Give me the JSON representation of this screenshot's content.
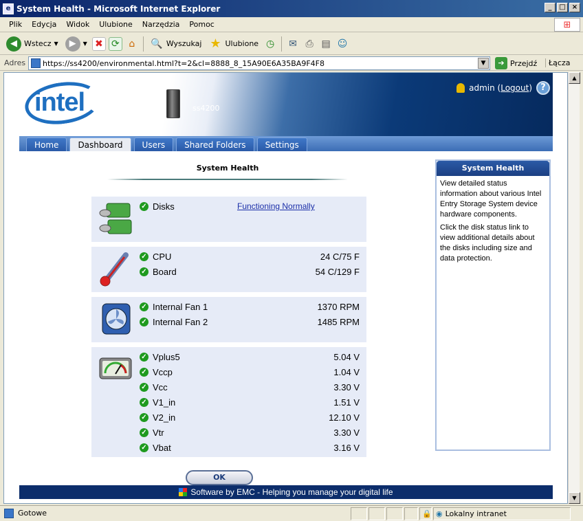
{
  "window": {
    "title": "System Health - Microsoft Internet Explorer"
  },
  "menu": [
    "Plik",
    "Edycja",
    "Widok",
    "Ulubione",
    "Narzędzia",
    "Pomoc"
  ],
  "toolbar": {
    "back": "Wstecz",
    "search": "Wyszukaj",
    "favorites": "Ulubione"
  },
  "address": {
    "label": "Adres",
    "url": "https://ss4200/environmental.html?t=2&cl=8888_8_15A90E6A35BA9F4F8",
    "go": "Przejdź",
    "links": "Łącza"
  },
  "header": {
    "logo_text": "intel",
    "device_name": "ss4200",
    "user": "admin",
    "logout": "Logout",
    "help": "?"
  },
  "tabs": [
    "Home",
    "Dashboard",
    "Users",
    "Shared Folders",
    "Settings"
  ],
  "main": {
    "heading": "System Health",
    "disks": {
      "label": "Disks",
      "link": "Functioning Normally"
    },
    "temps": [
      {
        "label": "CPU",
        "value": "24 C/75 F"
      },
      {
        "label": "Board",
        "value": "54 C/129 F"
      }
    ],
    "fans": [
      {
        "label": "Internal Fan 1",
        "value": "1370 RPM"
      },
      {
        "label": "Internal Fan 2",
        "value": "1485 RPM"
      }
    ],
    "voltages": [
      {
        "label": "Vplus5",
        "value": "5.04 V"
      },
      {
        "label": "Vccp",
        "value": "1.04 V"
      },
      {
        "label": "Vcc",
        "value": "3.30 V"
      },
      {
        "label": "V1_in",
        "value": "1.51 V"
      },
      {
        "label": "V2_in",
        "value": "12.10 V"
      },
      {
        "label": "Vtr",
        "value": "3.30 V"
      },
      {
        "label": "Vbat",
        "value": "3.16 V"
      }
    ],
    "ok": "OK"
  },
  "sidebar": {
    "title": "System Health",
    "p1": "View detailed status information about various Intel Entry Storage System device hardware components.",
    "p2": "Click the disk status link to view additional details about the disks including size and data protection."
  },
  "footer": {
    "text": "Software by EMC - Helping you manage your digital life"
  },
  "status": {
    "left": "Gotowe",
    "zone": "Lokalny intranet"
  }
}
